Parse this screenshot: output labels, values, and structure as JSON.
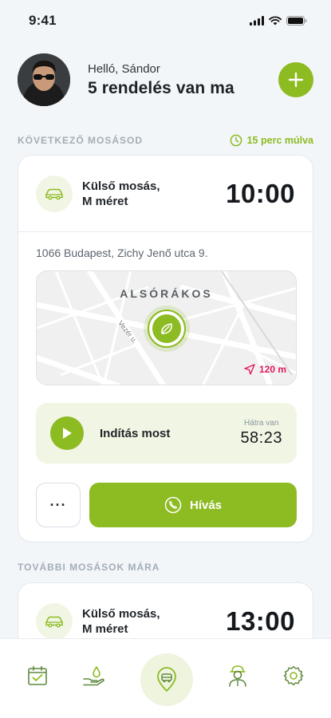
{
  "status_bar": {
    "time": "9:41"
  },
  "header": {
    "greeting": "Helló, Sándor",
    "subtitle": "5 rendelés van ma"
  },
  "next_wash": {
    "section_label": "KÖVETKEZŐ MOSÁSOD",
    "eta": "15 perc múlva",
    "service_name_line1": "Külső mosás,",
    "service_name_line2": "M méret",
    "time": "10:00",
    "address": "1066 Budapest, Zichy Jenő utca 9.",
    "map": {
      "district": "ALSÓRÁKOS",
      "street": "Vezér u.",
      "distance": "120 m"
    },
    "start_label": "Indítás most",
    "remaining_label": "Hátra van",
    "remaining_value": "58:23",
    "more_label": "···",
    "call_label": "Hívás"
  },
  "more_washes": {
    "section_label": "TOVÁBBI MOSÁSOK MÁRA",
    "items": [
      {
        "service_name_line1": "Külső mosás,",
        "service_name_line2": "M méret",
        "time": "13:00"
      }
    ]
  },
  "nav": {
    "items": [
      "calendar-icon",
      "water-hand-icon",
      "car-wash-pin-icon",
      "worker-icon",
      "gear-icon"
    ]
  },
  "colors": {
    "accent": "#8dbb22",
    "accent_light": "#f1f6e4",
    "distance": "#e0195c",
    "background": "#f3f6f9"
  }
}
